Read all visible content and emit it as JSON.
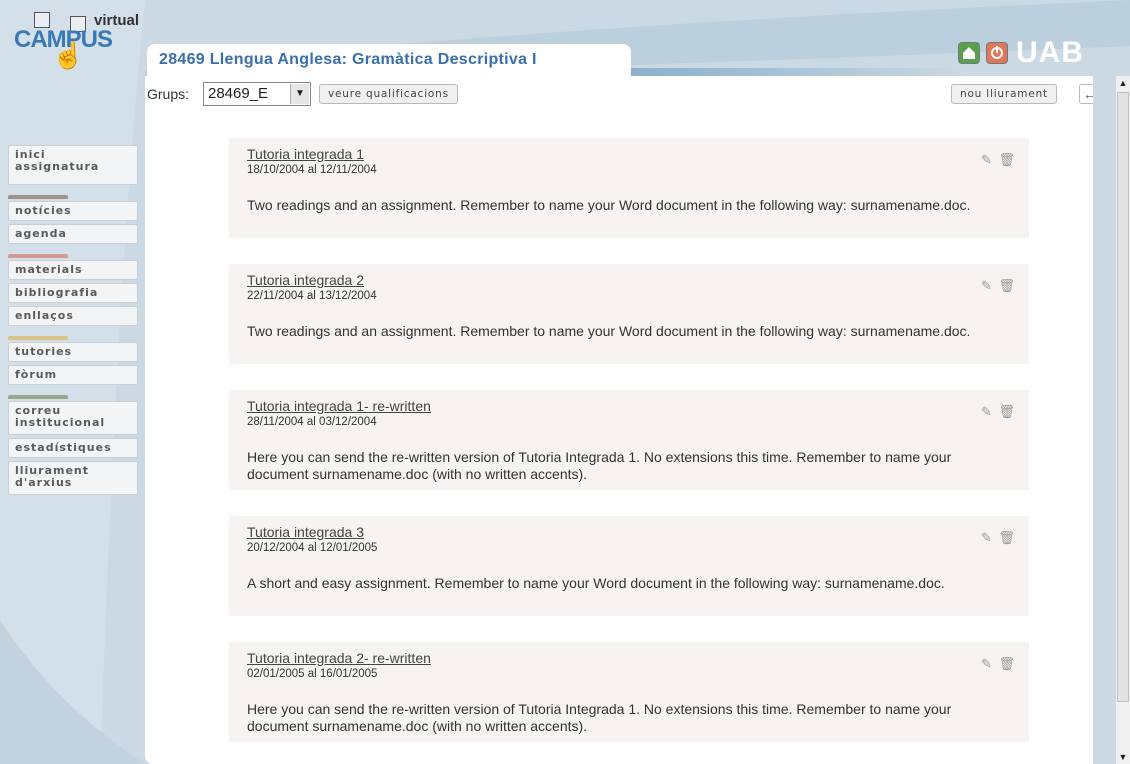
{
  "logo": {
    "virtual": "virtual",
    "campus": "CAMPUS"
  },
  "header": {
    "tab_title": "28469 Llengua Anglesa: Gramàtica Descriptiva I",
    "brand": "UAB",
    "home_icon": "home-icon",
    "power_icon": "power-icon"
  },
  "toolbar": {
    "grups_label": "Grups:",
    "grups_value": "28469_E",
    "grades_button": "veure qualificacions",
    "new_delivery_button": "nou lliurament",
    "back_icon": "←"
  },
  "sidebar": {
    "items": [
      {
        "label": "inici assignatura"
      },
      {
        "label": "notícies"
      },
      {
        "label": "agenda"
      },
      {
        "label": "materials"
      },
      {
        "label": "bibliografia"
      },
      {
        "label": "enllaços"
      },
      {
        "label": "tutories"
      },
      {
        "label": "fòrum"
      },
      {
        "label": "correu institucional"
      },
      {
        "label": "estadístiques"
      },
      {
        "label": "lliurament d'arxius"
      }
    ],
    "separator_colors": [
      "#a0948a",
      "#d39a93",
      "#d9c58a",
      "#9aa58c"
    ]
  },
  "tutorials": [
    {
      "title": "Tutoria integrada 1",
      "dates": "18/10/2004 al 12/11/2004",
      "description": "Two readings and an assignment. Remember to name your Word document in the following way: surnamename.doc."
    },
    {
      "title": "Tutoria integrada 2",
      "dates": "22/11/2004 al 13/12/2004",
      "description": "Two readings and an assignment. Remember to name your Word document in the following way: surnamename.doc."
    },
    {
      "title": "Tutoria integrada 1- re-written",
      "dates": "28/11/2004 al 03/12/2004",
      "description": "Here you can send the re-written version of Tutoria Integrada 1. No extensions this time. Remember to name your document surnamename.doc (with no written accents)."
    },
    {
      "title": "Tutoria integrada 3",
      "dates": "20/12/2004 al 12/01/2005",
      "description": "A short and easy assignment. Remember to name your Word document in the following way: surnamename.doc."
    },
    {
      "title": "Tutoria integrada 2- re-written",
      "dates": "02/01/2005 al 16/01/2005",
      "description": "Here you can send the re-written version of Tutoria Integrada 1. No extensions this time. Remember to name your document surnamename.doc (with no written accents)."
    }
  ],
  "card_actions": {
    "edit_icon": "✎",
    "delete_icon": "🗑"
  },
  "colors": {
    "accent": "#3a6fae",
    "campus_blue": "#3a79b8",
    "card_bg": "#f6f3f2"
  }
}
